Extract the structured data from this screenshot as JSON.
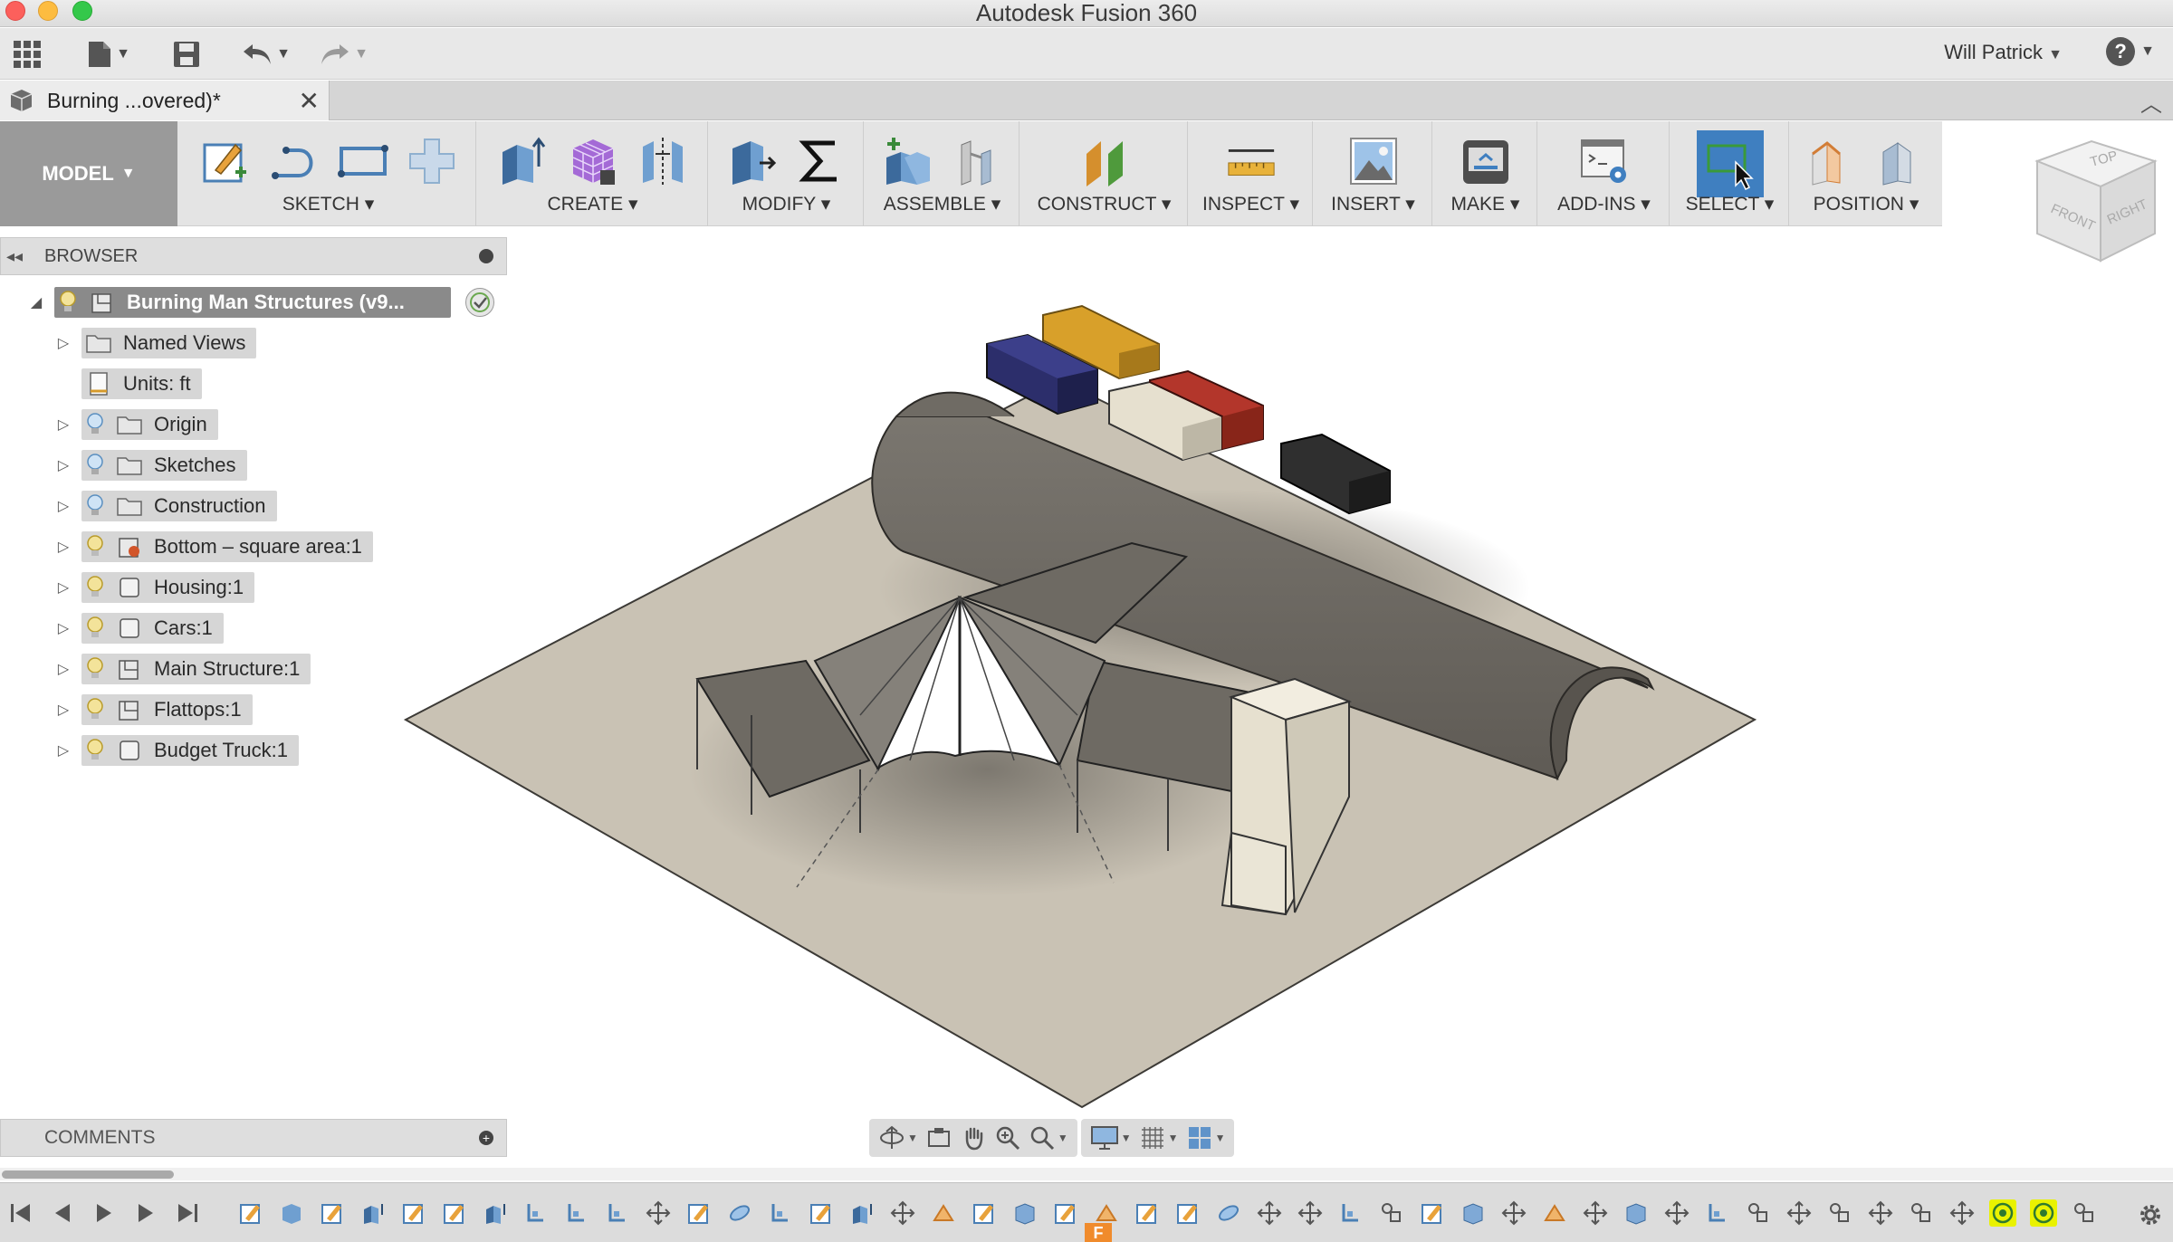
{
  "window": {
    "title": "Autodesk Fusion 360"
  },
  "app_toolbar": {
    "user": "Will Patrick",
    "help_label": "?"
  },
  "doc_tab": {
    "label": "Burning ...overed)*"
  },
  "ribbon": {
    "workspace": "MODEL",
    "groups": [
      {
        "label": "SKETCH"
      },
      {
        "label": "CREATE"
      },
      {
        "label": "MODIFY"
      },
      {
        "label": "ASSEMBLE"
      },
      {
        "label": "CONSTRUCT"
      },
      {
        "label": "INSPECT"
      },
      {
        "label": "INSERT"
      },
      {
        "label": "MAKE"
      },
      {
        "label": "ADD-INS"
      },
      {
        "label": "SELECT"
      },
      {
        "label": "POSITION"
      }
    ]
  },
  "view_cube": {
    "top": "TOP",
    "front": "FRONT",
    "right": "RIGHT"
  },
  "browser": {
    "title": "BROWSER",
    "root": "Burning Man Structures (v9...",
    "nodes": [
      {
        "label": "Named Views"
      },
      {
        "label": "Units: ft"
      },
      {
        "label": "Origin"
      },
      {
        "label": "Sketches"
      },
      {
        "label": "Construction"
      },
      {
        "label": "Bottom – square area:1"
      },
      {
        "label": "Housing:1"
      },
      {
        "label": "Cars:1"
      },
      {
        "label": "Main Structure:1"
      },
      {
        "label": "Flattops:1"
      },
      {
        "label": "Budget Truck:1"
      }
    ]
  },
  "comments": {
    "title": "COMMENTS"
  },
  "timeline": {
    "marker": "F"
  },
  "colors": {
    "ground": "#c9c2b4",
    "container_navy": "#2c2e6b",
    "container_gold": "#d8a02a",
    "container_red": "#b3362b",
    "container_cream": "#e6e0cf",
    "container_black": "#2f2f2f",
    "housing": "#6b6760",
    "select_blue": "#3f7fc0",
    "highlight_yellow": "#e9f200"
  }
}
